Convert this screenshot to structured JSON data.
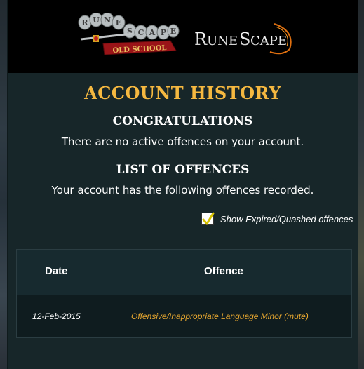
{
  "header": {
    "osrs_logo_text": "RuneScape Old School",
    "rs_logo_text": "RuneScape"
  },
  "page": {
    "title": "ACCOUNT HISTORY",
    "congrats_heading": "CONGRATULATIONS",
    "congrats_text": "There are no active offences on your account.",
    "list_heading": "LIST OF OFFENCES",
    "list_text": "Your account has the following offences recorded."
  },
  "filter": {
    "label": "Show Expired/Quashed offences",
    "checked": true
  },
  "table": {
    "columns": [
      "Date",
      "Offence"
    ],
    "rows": [
      {
        "date": "12-Feb-2015",
        "offence": "Offensive/Inappropriate Language Minor (mute)"
      }
    ]
  },
  "colors": {
    "title": "#f5b840",
    "offence_text": "#e8a830",
    "panel_bg": "#172629",
    "checkmark": "#d4c000"
  },
  "icons": {
    "checkbox": "checkmark-icon"
  }
}
